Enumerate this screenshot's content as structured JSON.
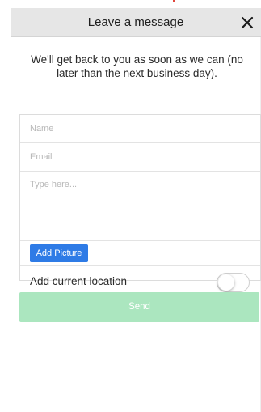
{
  "header": {
    "title": "Leave a message",
    "close_icon": "close-icon"
  },
  "intro_text": "We'll get back to you as soon as we can (no later than the next business day).",
  "form": {
    "name_placeholder": "Name",
    "email_placeholder": "Email",
    "message_placeholder": "Type here...",
    "add_picture_label": "Add Picture",
    "location_label": "Add current location",
    "location_enabled": false,
    "send_label": "Send"
  },
  "colors": {
    "header_bg": "#e6e6e6",
    "add_picture_bg": "#2e7be6",
    "send_bg": "#abe6bf",
    "accent_mark": "#e0463c"
  }
}
